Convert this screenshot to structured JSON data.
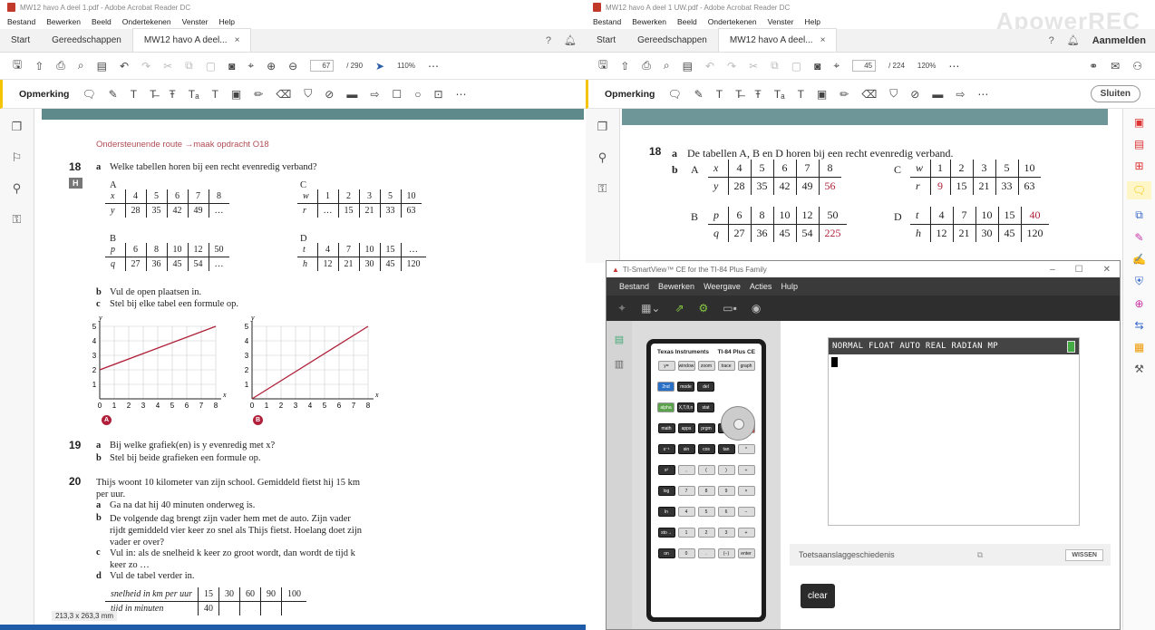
{
  "left_window": {
    "title": "MW12 havo A deel 1.pdf - Adobe Acrobat Reader DC",
    "menu": [
      "Bestand",
      "Bewerken",
      "Beeld",
      "Ondertekenen",
      "Venster",
      "Help"
    ],
    "tabs": [
      "Start",
      "Gereedschappen",
      "MW12 havo A deel..."
    ],
    "page_current": "67",
    "page_total": "/ 290",
    "zoom": "110%",
    "comment_label": "Opmerking",
    "status_size": "213,3 x 263,3 mm",
    "doc": {
      "route": "Ondersteunende route →maak opdracht O18",
      "q18_num": "18",
      "q18_a": "a",
      "q18_text": "Welke tabellen horen bij een recht evenredig verband?",
      "H": "H",
      "tableA": {
        "label": "A",
        "r1": [
          "x",
          "4",
          "5",
          "6",
          "7",
          "8"
        ],
        "r2": [
          "y",
          "28",
          "35",
          "42",
          "49",
          "…"
        ]
      },
      "tableB": {
        "label": "B",
        "r1": [
          "p",
          "6",
          "8",
          "10",
          "12",
          "50"
        ],
        "r2": [
          "q",
          "27",
          "36",
          "45",
          "54",
          "…"
        ]
      },
      "tableC": {
        "label": "C",
        "r1": [
          "w",
          "1",
          "2",
          "3",
          "5",
          "10"
        ],
        "r2": [
          "r",
          "…",
          "15",
          "21",
          "33",
          "63"
        ]
      },
      "tableD": {
        "label": "D",
        "r1": [
          "t",
          "4",
          "7",
          "10",
          "15",
          "…"
        ],
        "r2": [
          "h",
          "12",
          "21",
          "30",
          "45",
          "120"
        ]
      },
      "q18_b": "b",
      "q18_b_text": "Vul de open plaatsen in.",
      "q18_c": "c",
      "q18_c_text": "Stel bij elke tabel een formule op.",
      "graphA": "A",
      "graphB": "B",
      "q19_num": "19",
      "q19_a": "a",
      "q19_a_text": "Bij welke grafiek(en) is y evenredig met x?",
      "q19_b": "b",
      "q19_b_text": "Stel bij beide grafieken een formule op.",
      "q20_num": "20",
      "q20_intro": "Thijs woont 10 kilometer van zijn school. Gemiddeld fietst hij 15 km per uur.",
      "q20_a": "a",
      "q20_a_text": "Ga na dat hij 40 minuten onderweg is.",
      "q20_b": "b",
      "q20_b_text": "De volgende dag brengt zijn vader hem met de auto. Zijn vader rijdt gemiddeld vier keer zo snel als Thijs fietst. Hoelang doet zijn vader er over?",
      "q20_c": "c",
      "q20_c_text": "Vul in: als de snelheid k keer zo groot wordt, dan wordt de tijd k keer zo …",
      "q20_d": "d",
      "q20_d_text": "Vul de tabel verder in.",
      "speed_row": [
        "snelheid in km per uur",
        "15",
        "30",
        "60",
        "90",
        "100"
      ],
      "time_row": [
        "tijd in minuten",
        "40",
        "",
        "",
        "",
        ""
      ]
    }
  },
  "right_window": {
    "title": "MW12 havo A deel 1 UW.pdf - Adobe Acrobat Reader DC",
    "menu": [
      "Bestand",
      "Bewerken",
      "Beeld",
      "Ondertekenen",
      "Venster",
      "Help"
    ],
    "tabs": [
      "Start",
      "Gereedschappen",
      "MW12 havo A deel..."
    ],
    "login": "Aanmelden",
    "page_current": "45",
    "page_total": "/ 224",
    "zoom": "120%",
    "comment_label": "Opmerking",
    "close_label": "Sluiten",
    "watermark": "ApowerREC",
    "doc": {
      "q18_num": "18",
      "a": "a",
      "a_text": "De tabellen A, B en D horen bij een recht evenredig verband.",
      "b": "b",
      "A": {
        "label": "A",
        "r1": [
          "x",
          "4",
          "5",
          "6",
          "7",
          "8"
        ],
        "r2": [
          "y",
          "28",
          "35",
          "42",
          "49",
          "56"
        ]
      },
      "B": {
        "label": "B",
        "r1": [
          "p",
          "6",
          "8",
          "10",
          "12",
          "50"
        ],
        "r2": [
          "q",
          "27",
          "36",
          "45",
          "54",
          "225"
        ]
      },
      "C": {
        "label": "C",
        "r1": [
          "w",
          "1",
          "2",
          "3",
          "5",
          "10"
        ],
        "r2": [
          "r",
          "9",
          "15",
          "21",
          "33",
          "63"
        ]
      },
      "D": {
        "label": "D",
        "r1": [
          "t",
          "4",
          "7",
          "10",
          "15",
          "40"
        ],
        "r2": [
          "h",
          "12",
          "21",
          "30",
          "45",
          "120"
        ]
      }
    }
  },
  "ti": {
    "title": "TI-SmartView™ CE for the TI-84 Plus Family",
    "menu": [
      "Bestand",
      "Bewerken",
      "Weergave",
      "Acties",
      "Hulp"
    ],
    "brand": "Texas Instruments",
    "model": "TI-84 Plus CE",
    "lcd_status": "NORMAL FLOAT AUTO REAL RADIAN MP",
    "history_label": "Toetsaanslaggeschiedenis",
    "wissen": "WISSEN",
    "clear": "clear",
    "keys": [
      [
        "y=",
        "window",
        "zoom",
        "trace",
        "graph"
      ],
      [
        "2nd",
        "mode",
        "del"
      ],
      [
        "alpha",
        "X,T,θ,n",
        "stat"
      ],
      [
        "math",
        "apps",
        "prgm",
        "vars",
        "clear"
      ],
      [
        "x⁻¹",
        "sin",
        "cos",
        "tan",
        "^"
      ],
      [
        "x²",
        ",",
        "(",
        ")",
        "÷"
      ],
      [
        "log",
        "7",
        "8",
        "9",
        "×"
      ],
      [
        "ln",
        "4",
        "5",
        "6",
        "−"
      ],
      [
        "sto→",
        "1",
        "2",
        "3",
        "+"
      ],
      [
        "on",
        "0",
        ".",
        "(−)",
        "enter"
      ]
    ]
  },
  "chart_data": [
    {
      "type": "line",
      "title": "",
      "label": "A",
      "x": [
        0,
        8
      ],
      "y": [
        2,
        5
      ],
      "xlim": [
        0,
        8
      ],
      "ylim": [
        0,
        5
      ],
      "xlabel": "x",
      "ylabel": "y",
      "grid": true,
      "xticks": [
        "0",
        "1",
        "2",
        "3",
        "4",
        "5",
        "6",
        "7",
        "8"
      ],
      "yticks": [
        "1",
        "2",
        "3",
        "4",
        "5"
      ]
    },
    {
      "type": "line",
      "title": "",
      "label": "B",
      "x": [
        0,
        8
      ],
      "y": [
        0,
        5
      ],
      "xlim": [
        0,
        8
      ],
      "ylim": [
        0,
        5
      ],
      "xlabel": "x",
      "ylabel": "y",
      "grid": true,
      "xticks": [
        "0",
        "1",
        "2",
        "3",
        "4",
        "5",
        "6",
        "7",
        "8"
      ],
      "yticks": [
        "1",
        "2",
        "3",
        "4",
        "5"
      ]
    }
  ]
}
